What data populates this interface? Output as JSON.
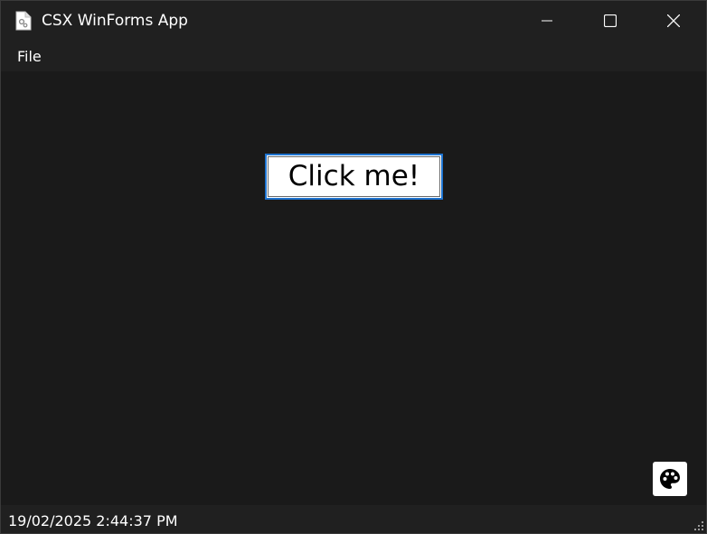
{
  "window": {
    "title": "CSX WinForms App",
    "app_icon": "app-gear-document-icon",
    "caption_buttons": {
      "minimize": "minimize-icon",
      "maximize": "maximize-icon",
      "close": "close-icon"
    }
  },
  "menu": {
    "items": [
      {
        "label": "File"
      }
    ]
  },
  "main": {
    "button_label": "Click me!",
    "theme_toggle_icon": "palette-icon"
  },
  "status": {
    "text": "19/02/2025 2:44:37 PM",
    "grip_icon": "resize-grip-icon"
  },
  "colors": {
    "titlebar_bg": "#202020",
    "client_bg": "#1a1a1a",
    "button_focus": "#1f74d0",
    "text": "#ffffff"
  }
}
